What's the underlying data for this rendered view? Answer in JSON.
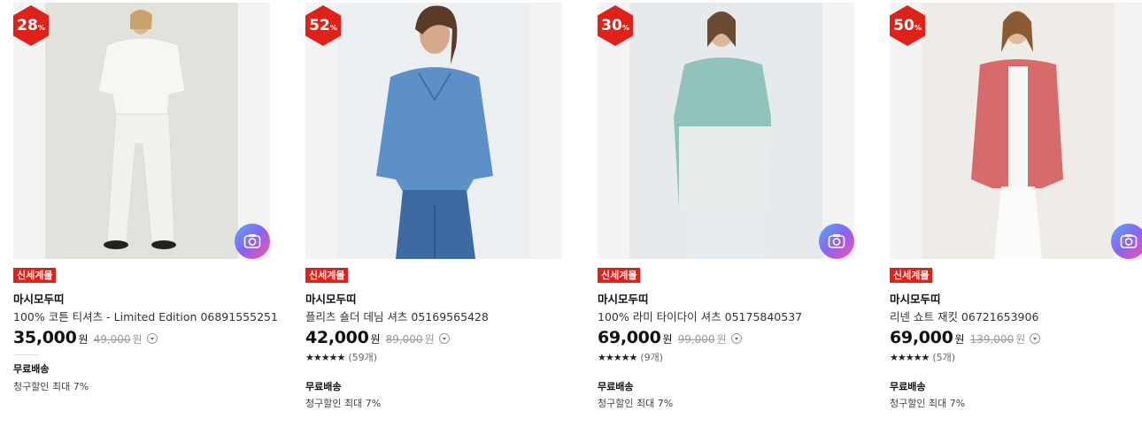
{
  "products": [
    {
      "sale_num": "28",
      "sale_unit": "%",
      "tag": "신세계몰",
      "brand": "마시모두띠",
      "name": "100% 코튼 티셔츠 - Limited Edition 06891555251",
      "price": "35,000",
      "won": "원",
      "original_price": "49,000",
      "won2": "원",
      "shipping": "무료배송",
      "discount": "청구할인 최대 7%"
    },
    {
      "sale_num": "52",
      "sale_unit": "%",
      "tag": "신세계몰",
      "brand": "마시모두띠",
      "name": "플리츠 숄더 데님 셔츠 05169565428",
      "price": "42,000",
      "won": "원",
      "original_price": "89,000",
      "won2": "원",
      "stars": "★★★★★",
      "review_count": "(59개)",
      "shipping": "무료배송",
      "discount": "청구할인 최대 7%"
    },
    {
      "sale_num": "30",
      "sale_unit": "%",
      "tag": "신세계몰",
      "brand": "마시모두띠",
      "name": "100% 라미 타이다이 셔츠 05175840537",
      "price": "69,000",
      "won": "원",
      "original_price": "99,000",
      "won2": "원",
      "stars": "★★★★★",
      "review_count": "(9개)",
      "shipping": "무료배송",
      "discount": "청구할인 최대 7%"
    },
    {
      "sale_num": "50",
      "sale_unit": "%",
      "tag": "신세계몰",
      "brand": "마시모두띠",
      "name": "리넨 쇼트 재킷 06721653906",
      "price": "69,000",
      "won": "원",
      "original_price": "139,000",
      "won2": "원",
      "stars": "★★★★★",
      "review_count": "(5개)",
      "shipping": "무료배송",
      "discount": "청구할인 최대 7%"
    }
  ],
  "colors": {
    "sale_badge": "#e0211a",
    "tag_bg": "#e0211a",
    "camera_gradient": [
      "#57a7ff",
      "#8a63f0",
      "#ff4fa6"
    ]
  },
  "icons": {
    "camera": "camera-search-icon",
    "info": "chevron-down-circle-icon"
  }
}
